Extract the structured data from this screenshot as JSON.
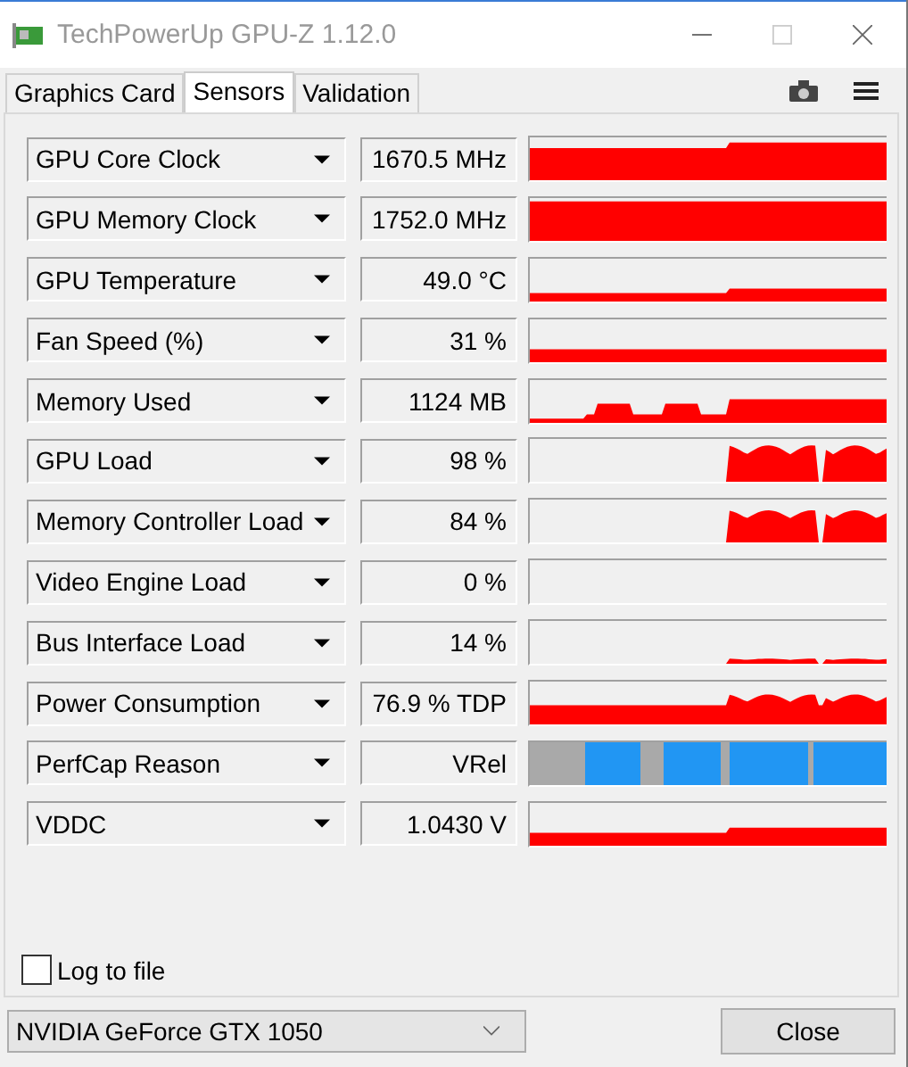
{
  "window": {
    "title": "TechPowerUp GPU-Z 1.12.0"
  },
  "tabs": [
    {
      "label": "Graphics Card",
      "selected": false
    },
    {
      "label": "Sensors",
      "selected": true
    },
    {
      "label": "Validation",
      "selected": false
    }
  ],
  "sensors": [
    {
      "name": "GPU Core Clock",
      "value": "1670.5 MHz",
      "kind": "graph"
    },
    {
      "name": "GPU Memory Clock",
      "value": "1752.0 MHz",
      "kind": "graph"
    },
    {
      "name": "GPU Temperature",
      "value": "49.0 °C",
      "kind": "graph"
    },
    {
      "name": "Fan Speed (%)",
      "value": "31 %",
      "kind": "graph"
    },
    {
      "name": "Memory Used",
      "value": "1124 MB",
      "kind": "graph"
    },
    {
      "name": "GPU Load",
      "value": "98 %",
      "kind": "graph"
    },
    {
      "name": "Memory Controller Load",
      "value": "84 %",
      "kind": "graph"
    },
    {
      "name": "Video Engine Load",
      "value": "0 %",
      "kind": "graph"
    },
    {
      "name": "Bus Interface Load",
      "value": "14 %",
      "kind": "graph"
    },
    {
      "name": "Power Consumption",
      "value": "76.9 % TDP",
      "kind": "graph"
    },
    {
      "name": "PerfCap Reason",
      "value": "VRel",
      "kind": "perfcap"
    },
    {
      "name": "VDDC",
      "value": "1.0430 V",
      "kind": "graph"
    }
  ],
  "log_to_file": {
    "label": "Log to file",
    "checked": false
  },
  "gpu_select": {
    "value": "NVIDIA GeForce GTX 1050"
  },
  "close_button": "Close"
}
